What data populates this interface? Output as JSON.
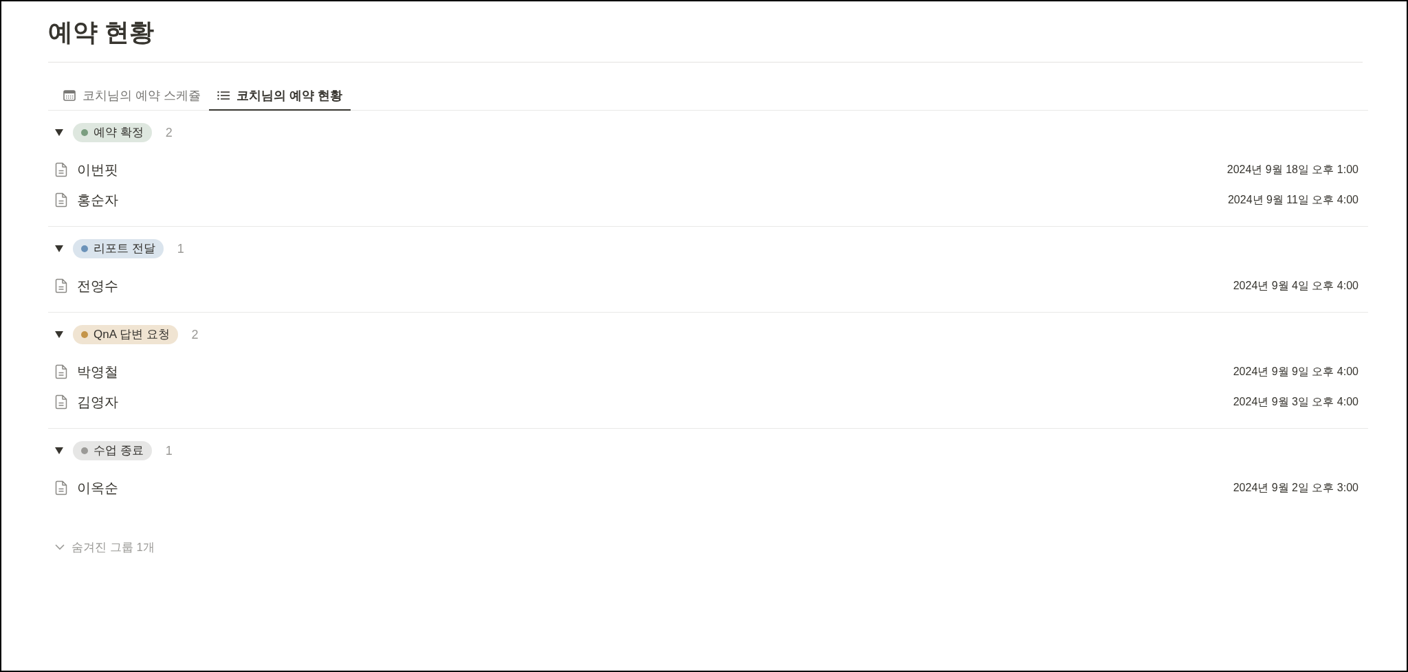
{
  "title": "예약 현황",
  "tabs": [
    {
      "label": "코치님의 예약 스케쥴",
      "kind": "calendar",
      "selected": false
    },
    {
      "label": "코치님의 예약 현황",
      "kind": "list",
      "selected": true
    }
  ],
  "groups": [
    {
      "label": "예약 확정",
      "color": "#7b9e80",
      "count": "2",
      "expanded": true,
      "items": [
        {
          "name": "이번핏",
          "date": "2024년 9월 18일 오후 1:00"
        },
        {
          "name": "홍순자",
          "date": "2024년 9월 11일 오후 4:00"
        }
      ]
    },
    {
      "label": "리포트 전달",
      "color": "#6b92b8",
      "count": "1",
      "expanded": true,
      "items": [
        {
          "name": "전영수",
          "date": "2024년 9월 4일 오후 4:00"
        }
      ]
    },
    {
      "label": "QnA 답변 요청",
      "color": "#c4954a",
      "count": "2",
      "expanded": true,
      "items": [
        {
          "name": "박영철",
          "date": "2024년 9월 9일 오후 4:00"
        },
        {
          "name": "김영자",
          "date": "2024년 9월 3일 오후 4:00"
        }
      ]
    },
    {
      "label": "수업 종료",
      "color": "#9b9a97",
      "count": "1",
      "expanded": true,
      "items": [
        {
          "name": "이옥순",
          "date": "2024년 9월 2일 오후 3:00"
        }
      ]
    }
  ],
  "hidden_groups": "숨겨진 그룹 1개"
}
